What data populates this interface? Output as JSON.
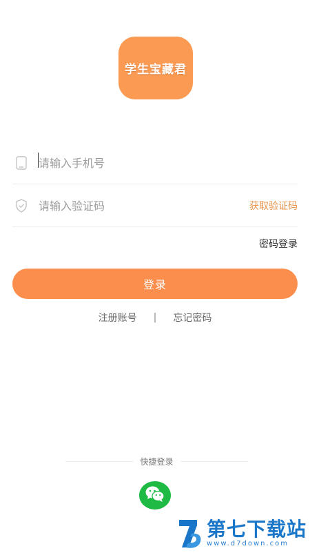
{
  "app": {
    "logo_text": "学生宝藏君",
    "brand_color": "#fb9a53"
  },
  "form": {
    "phone_placeholder": "请输入手机号",
    "code_placeholder": "请输入验证码",
    "get_code_label": "获取验证码",
    "password_login_label": "密码登录",
    "login_button_label": "登录",
    "icons": {
      "phone": "phone-icon",
      "code": "shield-icon"
    }
  },
  "links": {
    "register_label": "注册账号",
    "separator": "|",
    "forgot_label": "忘记密码"
  },
  "quick_login": {
    "label": "快捷登录",
    "wechat_icon": "wechat-icon",
    "wechat_color": "#1fba43"
  },
  "watermark": {
    "title": "第七下载站",
    "url": "www.d7down.com"
  }
}
